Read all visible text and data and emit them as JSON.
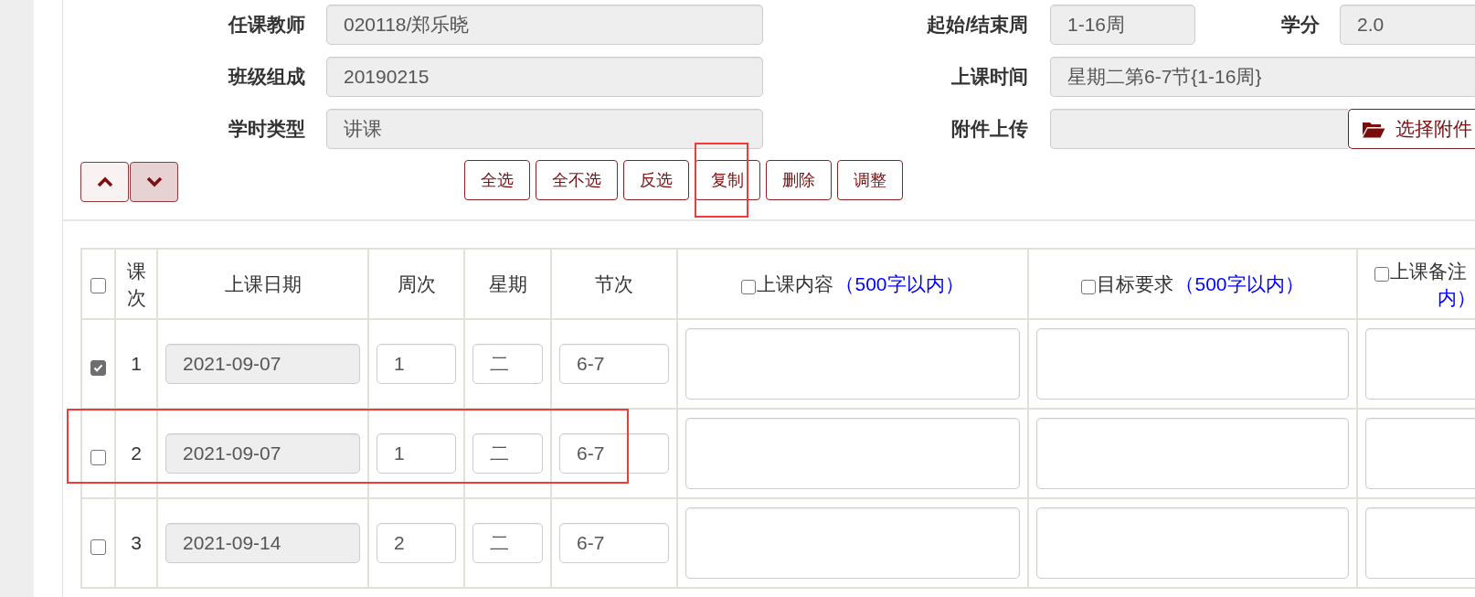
{
  "form": {
    "rows": [
      {
        "fields": [
          {
            "kind": "text",
            "label": "任课教师",
            "value": "020118/郑乐晓",
            "disabled": true
          },
          {
            "kind": "text",
            "label": "起始/结束周",
            "value": "1-16周",
            "disabled": true
          },
          {
            "kind": "text",
            "label": "学分",
            "value": "2.0",
            "disabled": true
          }
        ]
      },
      {
        "fields": [
          {
            "kind": "text",
            "label": "班级组成",
            "value": "20190215",
            "disabled": true
          },
          {
            "kind": "text",
            "label": "上课时间",
            "value": "星期二第6-7节{1-16周}",
            "disabled": true
          }
        ]
      },
      {
        "fields": [
          {
            "kind": "text",
            "label": "学时类型",
            "value": "讲课",
            "disabled": true
          },
          {
            "kind": "file",
            "label": "附件上传",
            "disabled": true,
            "button": "选择附件"
          }
        ]
      }
    ]
  },
  "order_buttons": [
    {
      "kind": "up",
      "pressed": false
    },
    {
      "kind": "down",
      "pressed": true
    }
  ],
  "actions": [
    {
      "label": "全选",
      "highlighted": false
    },
    {
      "label": "全不选",
      "highlighted": false
    },
    {
      "label": "反选",
      "highlighted": false
    },
    {
      "label": "复制",
      "highlighted": true
    },
    {
      "label": "删除",
      "highlighted": false
    },
    {
      "label": "调整",
      "highlighted": false
    }
  ],
  "table": {
    "columns": [
      {
        "kind": "checkbox",
        "checked": false
      },
      {
        "kind": "text",
        "label": "课次"
      },
      {
        "kind": "text",
        "label": "上课日期"
      },
      {
        "kind": "text",
        "label": "周次"
      },
      {
        "kind": "text",
        "label": "星期"
      },
      {
        "kind": "text",
        "label": "节次"
      },
      {
        "kind": "checkable",
        "label": "上课内容",
        "note": "（500字以内）",
        "checked": false
      },
      {
        "kind": "checkable",
        "label": "目标要求",
        "note": "（500字以内）",
        "checked": false
      },
      {
        "kind": "checkable",
        "label": "上课备注",
        "note": "内）",
        "checked": false
      }
    ],
    "rows": [
      {
        "highlighted": false,
        "cells": [
          {
            "kind": "checkbox",
            "checked": true
          },
          {
            "kind": "number",
            "text": "1"
          },
          {
            "kind": "input",
            "value": "2021-09-07",
            "disabled": true
          },
          {
            "kind": "input",
            "value": "1",
            "disabled": false
          },
          {
            "kind": "input",
            "value": "二",
            "disabled": false
          },
          {
            "kind": "input",
            "value": "6-7",
            "disabled": false
          },
          {
            "kind": "textarea"
          },
          {
            "kind": "textarea"
          },
          {
            "kind": "textarea"
          }
        ]
      },
      {
        "highlighted": true,
        "cells": [
          {
            "kind": "checkbox",
            "checked": false
          },
          {
            "kind": "number",
            "text": "2"
          },
          {
            "kind": "input",
            "value": "2021-09-07",
            "disabled": true
          },
          {
            "kind": "input",
            "value": "1",
            "disabled": false
          },
          {
            "kind": "input",
            "value": "二",
            "disabled": false
          },
          {
            "kind": "input",
            "value": "6-7",
            "disabled": false
          },
          {
            "kind": "textarea"
          },
          {
            "kind": "textarea"
          },
          {
            "kind": "textarea"
          }
        ]
      },
      {
        "highlighted": false,
        "cells": [
          {
            "kind": "checkbox",
            "checked": false
          },
          {
            "kind": "number",
            "text": "3"
          },
          {
            "kind": "input",
            "value": "2021-09-14",
            "disabled": true
          },
          {
            "kind": "input",
            "value": "2",
            "disabled": false
          },
          {
            "kind": "input",
            "value": "二",
            "disabled": false
          },
          {
            "kind": "input",
            "value": "6-7",
            "disabled": false
          },
          {
            "kind": "textarea"
          },
          {
            "kind": "textarea"
          },
          {
            "kind": "textarea"
          }
        ]
      }
    ]
  }
}
